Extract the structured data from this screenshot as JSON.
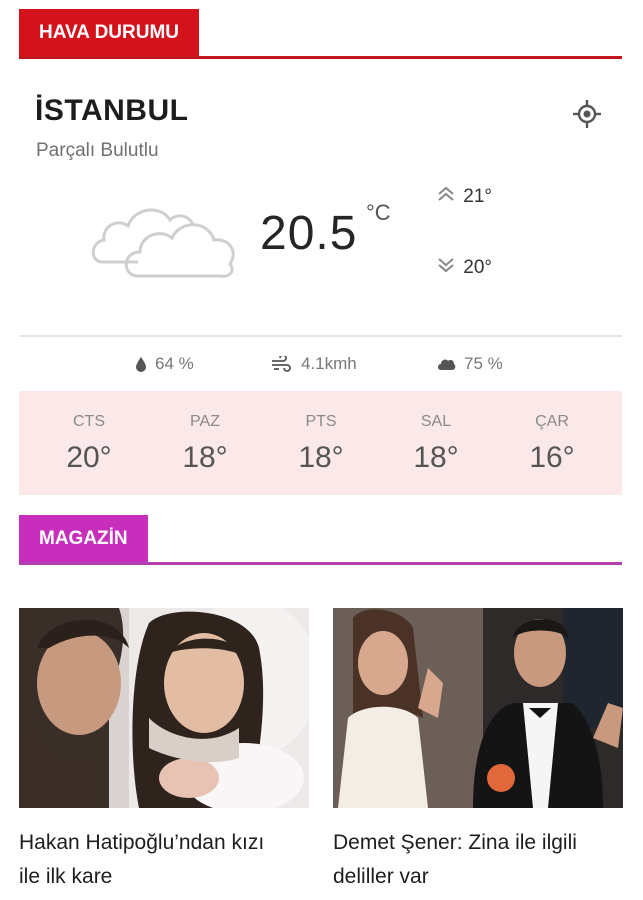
{
  "weather": {
    "section_label": "HAVA DURUMU",
    "city": "İSTANBUL",
    "condition": "Parçalı Bulutlu",
    "temperature": "20.5",
    "unit": "°C",
    "high": "21°",
    "low": "20°",
    "humidity": "64 %",
    "wind": "4.1kmh",
    "cloudiness": "75 %",
    "icons": {
      "locate": "crosshair-icon",
      "condition": "cloud-icon",
      "high": "chevrons-up-icon",
      "low": "chevrons-down-icon",
      "humidity": "droplet-icon",
      "wind": "wind-icon",
      "cloudiness": "cloud-icon"
    },
    "forecast": [
      {
        "day": "CTS",
        "temp": "20°"
      },
      {
        "day": "PAZ",
        "temp": "18°"
      },
      {
        "day": "PTS",
        "temp": "18°"
      },
      {
        "day": "SAL",
        "temp": "18°"
      },
      {
        "day": "ÇAR",
        "temp": "16°"
      }
    ]
  },
  "magazin": {
    "section_label": "MAGAZİN",
    "articles": [
      {
        "title_line1": "Hakan Hatipoğlu’ndan kızı",
        "title_line2": "ile ilk kare"
      },
      {
        "title_line1": "Demet Şener: Zina ile ilgili",
        "title_line2": "deliller var"
      }
    ]
  },
  "colors": {
    "weather_accent": "#d4121b",
    "magazin_accent": "#c72ebc",
    "forecast_bg": "#fbe9e9"
  }
}
